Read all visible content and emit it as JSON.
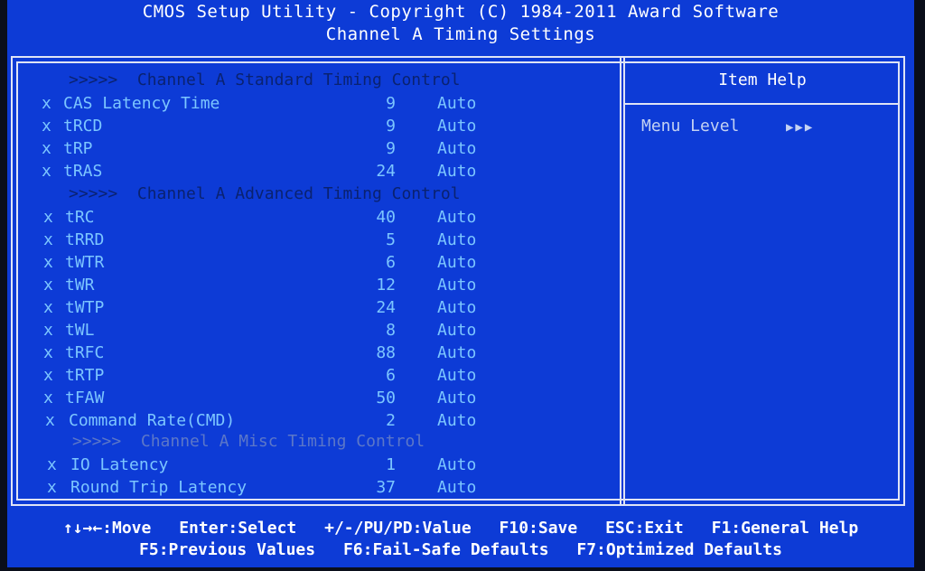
{
  "title": {
    "line1": "CMOS Setup Utility - Copyright (C) 1984-2011 Award Software",
    "line2": "Channel A Timing Settings"
  },
  "sections": [
    "Channel A Standard Timing Control",
    "Channel A Advanced Timing Control",
    "Channel A Misc Timing Control"
  ],
  "section_prefix": ">>>>>",
  "items": [
    {
      "marker": "x",
      "name": "CAS Latency Time",
      "value": "9",
      "mode": "Auto"
    },
    {
      "marker": "x",
      "name": "tRCD",
      "value": "9",
      "mode": "Auto"
    },
    {
      "marker": "x",
      "name": "tRP",
      "value": "9",
      "mode": "Auto"
    },
    {
      "marker": "x",
      "name": "tRAS",
      "value": "24",
      "mode": "Auto"
    },
    {
      "marker": "x",
      "name": "tRC",
      "value": "40",
      "mode": "Auto"
    },
    {
      "marker": "x",
      "name": "tRRD",
      "value": "5",
      "mode": "Auto"
    },
    {
      "marker": "x",
      "name": "tWTR",
      "value": "6",
      "mode": "Auto"
    },
    {
      "marker": "x",
      "name": "tWR",
      "value": "12",
      "mode": "Auto"
    },
    {
      "marker": "x",
      "name": "tWTP",
      "value": "24",
      "mode": "Auto"
    },
    {
      "marker": "x",
      "name": "tWL",
      "value": "8",
      "mode": "Auto"
    },
    {
      "marker": "x",
      "name": "tRFC",
      "value": "88",
      "mode": "Auto"
    },
    {
      "marker": "x",
      "name": "tRTP",
      "value": "6",
      "mode": "Auto"
    },
    {
      "marker": "x",
      "name": "tFAW",
      "value": "50",
      "mode": "Auto"
    },
    {
      "marker": "x",
      "name": "Command Rate(CMD)",
      "value": "2",
      "mode": "Auto"
    },
    {
      "marker": "x",
      "name": "IO Latency",
      "value": "1",
      "mode": "Auto"
    },
    {
      "marker": "x",
      "name": "Round Trip Latency",
      "value": "37",
      "mode": "Auto"
    }
  ],
  "help": {
    "title": "Item Help",
    "menu_level_label": "Menu Level",
    "menu_level_arrows": "▶▶▶"
  },
  "footer": {
    "line1": [
      "↑↓→←:Move",
      "Enter:Select",
      "+/-/PU/PD:Value",
      "F10:Save",
      "ESC:Exit",
      "F1:General Help"
    ],
    "line2": [
      "F5:Previous Values",
      "F6:Fail-Safe Defaults",
      "F7:Optimized Defaults"
    ]
  },
  "colors": {
    "background": "#0d3bd6",
    "item_text": "#7cc6ff",
    "header_dark": "#0a2270",
    "header_dim": "#5c77c8",
    "frame": "#dfe4f5"
  }
}
